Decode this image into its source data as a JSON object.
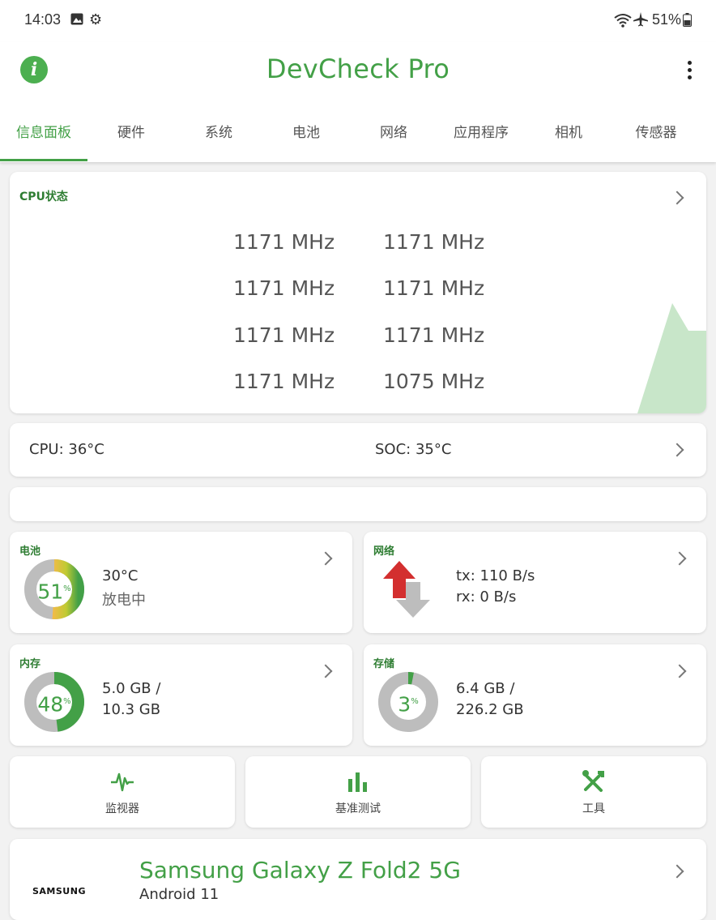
{
  "status_bar": {
    "time": "14:03",
    "battery_percent": "51%",
    "icons": [
      "image-icon",
      "gear-icon",
      "wifi-icon",
      "airplane-icon",
      "battery-icon"
    ]
  },
  "app": {
    "title": "DevCheck Pro",
    "accent_color": "#43a047"
  },
  "tabs": [
    "信息面板",
    "硬件",
    "系统",
    "电池",
    "网络",
    "应用程序",
    "相机",
    "传感器"
  ],
  "active_tab_index": 0,
  "cpu": {
    "title": "CPU状态",
    "frequencies": [
      "1171 MHz",
      "1171 MHz",
      "1171 MHz",
      "1171 MHz",
      "1171 MHz",
      "1171 MHz",
      "1171 MHz",
      "1075 MHz"
    ]
  },
  "temps": {
    "cpu": "CPU: 36°C",
    "soc": "SOC: 35°C"
  },
  "battery": {
    "title": "电池",
    "percent": "51",
    "percent_sign": "%",
    "level": 0.51,
    "temp": "30°C",
    "state": "放电中"
  },
  "network": {
    "title": "网络",
    "tx": "tx: 110 B/s",
    "rx": "rx: 0 B/s"
  },
  "memory": {
    "title": "内存",
    "percent": "48",
    "percent_sign": "%",
    "level": 0.48,
    "used": "5.0 GB /",
    "total": "10.3 GB"
  },
  "storage": {
    "title": "存储",
    "percent": "3",
    "percent_sign": "%",
    "level": 0.03,
    "used": "6.4 GB /",
    "total": "226.2 GB"
  },
  "tools": {
    "monitor": "监视器",
    "benchmark": "基准测试",
    "tools": "工具"
  },
  "device": {
    "brand": "SAMSUNG",
    "name": "Samsung Galaxy Z Fold2 5G",
    "os": "Android 11"
  }
}
